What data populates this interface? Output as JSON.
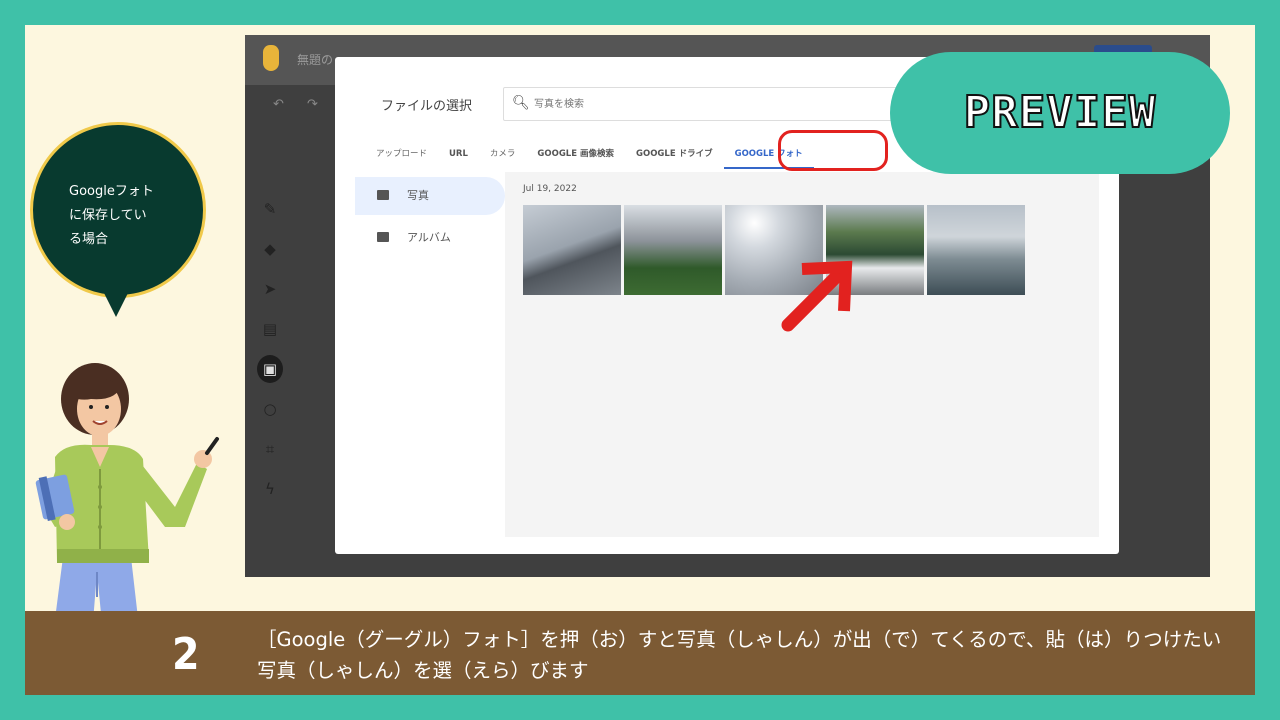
{
  "app": {
    "title": "無題の",
    "undo_icon": "undo-icon",
    "redo_icon": "redo-icon",
    "tools": [
      "pen-icon",
      "eraser-icon",
      "cursor-icon",
      "sticky-note-icon",
      "image-icon",
      "circle-icon",
      "frame-icon",
      "laser-icon"
    ]
  },
  "dialog": {
    "title": "ファイルの選択",
    "search_placeholder": "写真を検索",
    "tabs": [
      "アップロード",
      "URL",
      "カメラ",
      "GOOGLE 画像検索",
      "GOOGLE ドライブ",
      "GOOGLE フォト"
    ],
    "active_tab": "GOOGLE フォト",
    "nav": [
      {
        "label": "写真",
        "icon": "photo-icon",
        "active": true
      },
      {
        "label": "アルバム",
        "icon": "album-icon",
        "active": false
      }
    ],
    "date_label": "Jul 19, 2022",
    "photos": [
      "building-photo",
      "tower-trees-photo",
      "sky-photo",
      "boat-photo",
      "waterfront-photo"
    ]
  },
  "preview_badge": "PREVIEW",
  "bubble": {
    "lines": [
      "Googleフォト",
      "に保存してい",
      "る場合"
    ]
  },
  "caption": {
    "step": "2",
    "text": "［Google（グーグル）フォト］を押（お）すと写真（しゃしん）が出（で）てくるので、貼（は）りつけたい写真（しゃしん）を選（えら）びます"
  },
  "colors": {
    "frame": "#3fc1a8",
    "slide": "#fdf7df",
    "caption_bar": "#7c5a34",
    "bubble": "#083a2f",
    "highlight": "#e2221f",
    "accent_tab": "#3567c9"
  }
}
